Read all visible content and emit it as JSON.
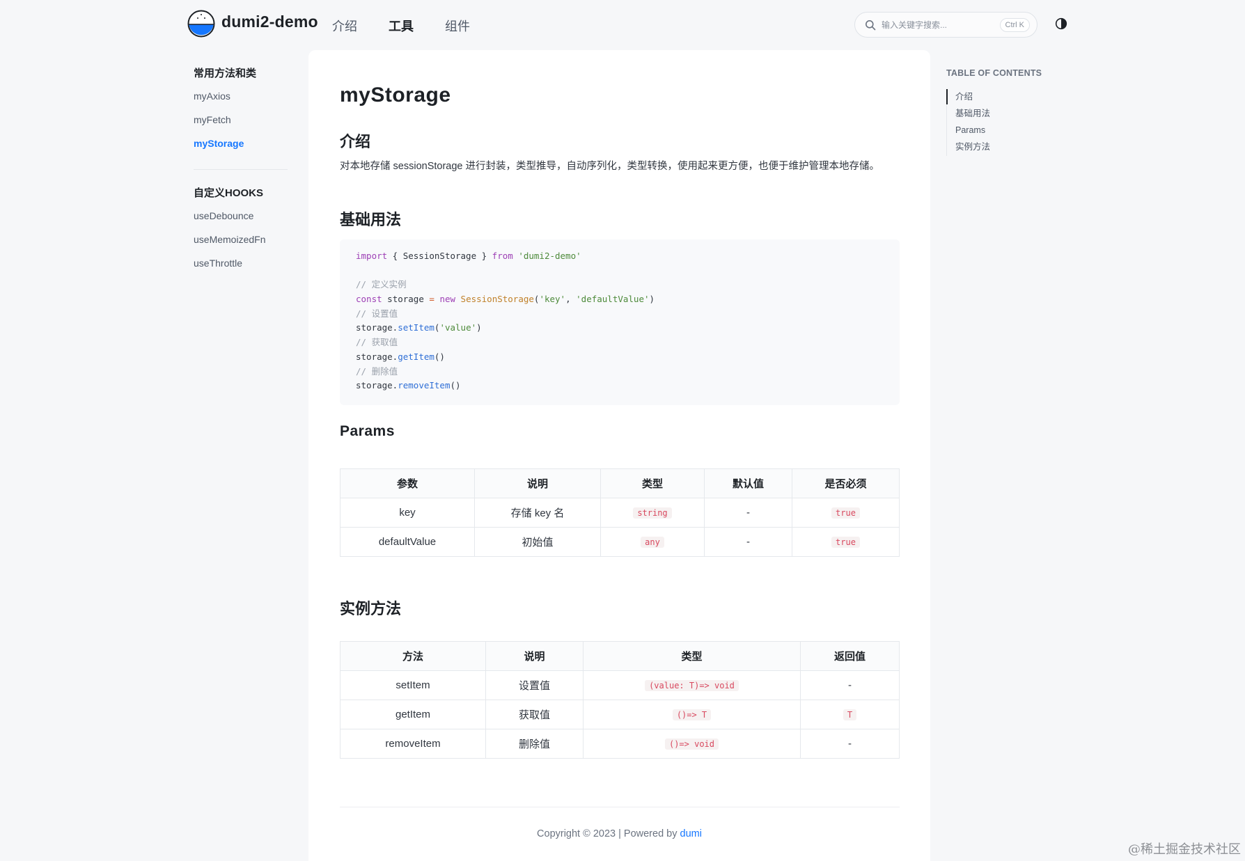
{
  "header": {
    "brand": "dumi2-demo",
    "nav": [
      "介绍",
      "工具",
      "组件"
    ],
    "search_placeholder": "输入关键字搜索...",
    "search_shortcut": "Ctrl K"
  },
  "sidebar": {
    "groups": [
      {
        "title": "常用方法和类",
        "items": [
          "myAxios",
          "myFetch",
          "myStorage"
        ]
      },
      {
        "title": "自定义HOOKS",
        "items": [
          "useDebounce",
          "useMemoizedFn",
          "useThrottle"
        ]
      }
    ],
    "active_item": "myStorage"
  },
  "main": {
    "title": "myStorage",
    "intro_heading": "介绍",
    "intro_text": "对本地存储 sessionStorage 进行封装，类型推导，自动序列化，类型转换，使用起来更方便，也便于维护管理本地存储。",
    "usage_heading": "基础用法",
    "code": {
      "line1": [
        "import",
        " { SessionStorage } ",
        "from",
        " ",
        "'dumi2-demo'"
      ],
      "comment1": "// 定义实例",
      "line3": [
        "const",
        " storage ",
        "=",
        " ",
        "new",
        " ",
        "SessionStorage",
        "(",
        "'key'",
        ", ",
        "'defaultValue'",
        ")"
      ],
      "comment2": "// 设置值",
      "line5": [
        "storage.",
        "setItem",
        "(",
        "'value'",
        ")"
      ],
      "comment3": "// 获取值",
      "line7": [
        "storage.",
        "getItem",
        "()"
      ],
      "comment4": "// 删除值",
      "line9": [
        "storage.",
        "removeItem",
        "()"
      ]
    },
    "params_heading": "Params",
    "params_table": {
      "headers": [
        "参数",
        "说明",
        "类型",
        "默认值",
        "是否必须"
      ],
      "rows": [
        [
          "key",
          "存储 key 名",
          "string",
          "-",
          "true"
        ],
        [
          "defaultValue",
          "初始值",
          "any",
          "-",
          "true"
        ]
      ]
    },
    "methods_heading": "实例方法",
    "methods_table": {
      "headers": [
        "方法",
        "说明",
        "类型",
        "返回值"
      ],
      "rows": [
        [
          "setItem",
          "设置值",
          "(value: T)=> void",
          "-"
        ],
        [
          "getItem",
          "获取值",
          "()=> T",
          "T"
        ],
        [
          "removeItem",
          "删除值",
          "()=> void",
          "-"
        ]
      ]
    },
    "footer_text": "Copyright © 2023 | Powered by ",
    "footer_link": "dumi"
  },
  "toc": {
    "title": "TABLE OF CONTENTS",
    "items": [
      "介绍",
      "基础用法",
      "Params",
      "实例方法"
    ]
  },
  "watermark": "@稀土掘金技术社区",
  "colors": {
    "accent": "#1677ff",
    "code_tag": "#d8485e",
    "background": "#f6f7f9"
  }
}
